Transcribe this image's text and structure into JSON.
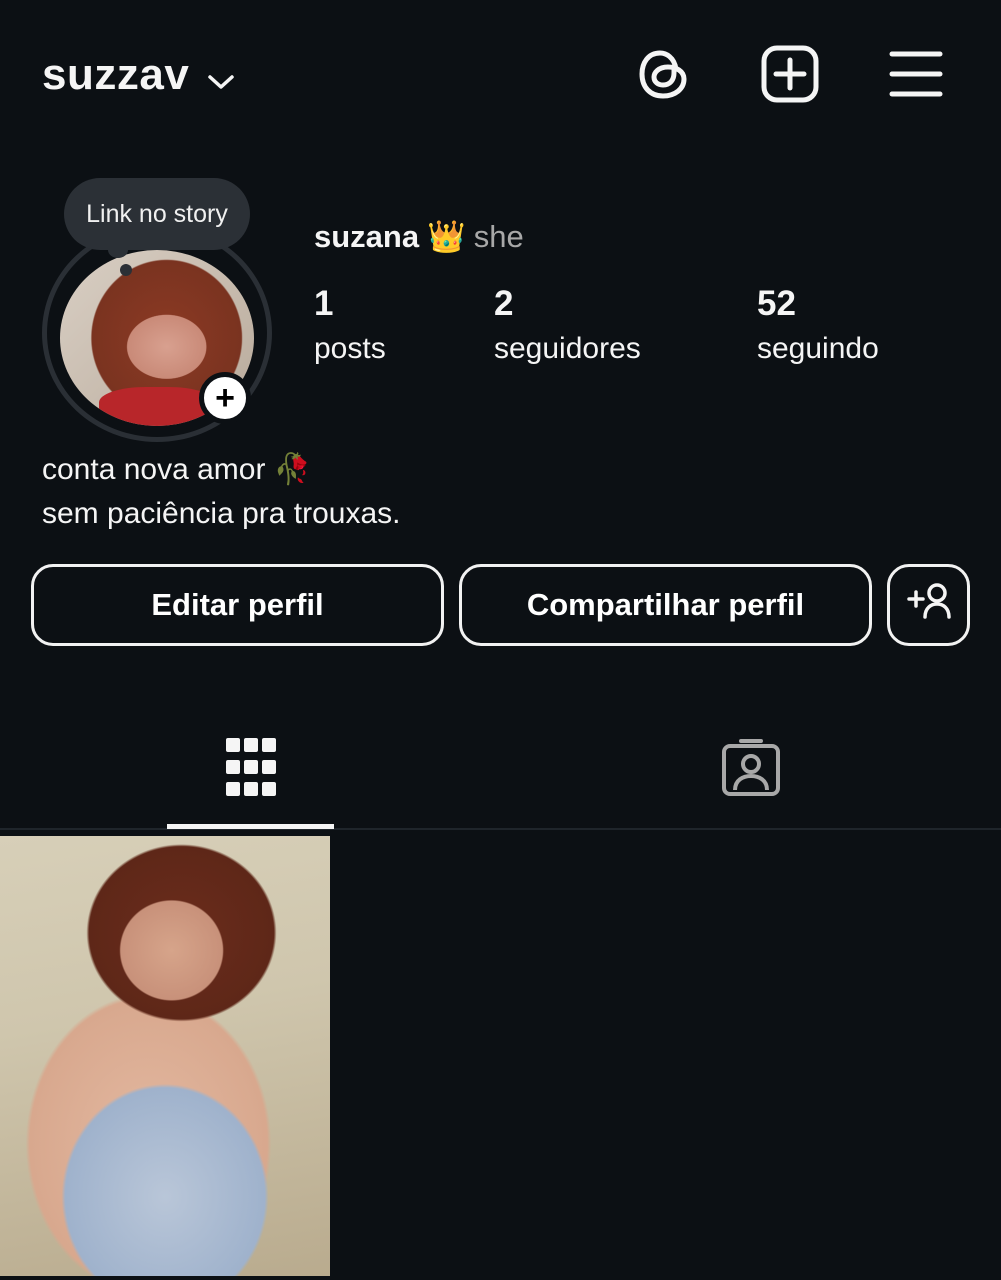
{
  "header": {
    "username": "suzzav",
    "icons": [
      "chevron-down-icon",
      "threads-icon",
      "new-post-icon",
      "menu-icon"
    ]
  },
  "story_note": {
    "text": "Link no story"
  },
  "profile": {
    "display_name": "suzana",
    "emoji": "👑",
    "pronouns": "she",
    "stats": [
      {
        "value": "1",
        "label": "posts"
      },
      {
        "value": "2",
        "label": "seguidores"
      },
      {
        "value": "52",
        "label": "seguindo"
      }
    ],
    "bio_lines": [
      "conta nova amor 🥀",
      "sem paciência pra trouxas."
    ]
  },
  "buttons": {
    "edit": "Editar perfil",
    "share": "Compartilhar perfil"
  },
  "tabs": [
    {
      "icon": "grid-icon",
      "active": true
    },
    {
      "icon": "tagged-icon",
      "active": false
    }
  ],
  "colors": {
    "background": "#0c1014",
    "text": "#f5f5f5",
    "muted": "#a8a8a8",
    "bubble": "#2b3036"
  }
}
